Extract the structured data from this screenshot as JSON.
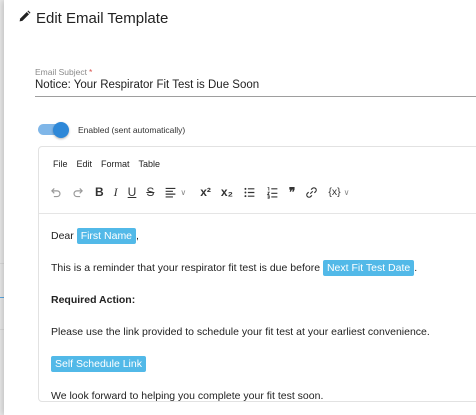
{
  "modal": {
    "title": "Edit Email Template",
    "subject_label": "Email Subject",
    "subject_required_mark": "*",
    "subject_value": "Notice: Your Respirator Fit Test is Due Soon",
    "toggle_label": "Enabled (sent automatically)",
    "toggle_on": true,
    "accent_color": "#2e88d8"
  },
  "editor": {
    "menu": [
      "File",
      "Edit",
      "Format",
      "Table"
    ],
    "toolbar_icons": [
      "undo-icon",
      "redo-icon",
      "bold-icon",
      "italic-icon",
      "underline-icon",
      "strikethrough-icon",
      "align-icon",
      "superscript-icon",
      "subscript-icon",
      "bullet-list-icon",
      "numbered-list-icon",
      "blockquote-icon",
      "link-icon",
      "variable-icon"
    ],
    "toolbar": {
      "bold": "B",
      "italic": "I",
      "underline": "U",
      "strike": "S",
      "superscript": "x²",
      "subscript": "x₂",
      "quote": "❞",
      "variable": "{x}"
    },
    "content": {
      "greeting": "Dear",
      "greeting_tag": "First Name",
      "greeting_after": ",",
      "reminder_text": "This is a reminder that your respirator fit test is due before",
      "reminder_tag": "Next Fit Test Date",
      "reminder_after": ".",
      "required_heading": "Required Action:",
      "instructions": "Please use the link provided to schedule your fit test at your earliest convenience.",
      "link_tag": "Self Schedule Link",
      "closing": "We look forward to helping you complete your fit test soon."
    },
    "tag_color": "#52b9e8"
  }
}
